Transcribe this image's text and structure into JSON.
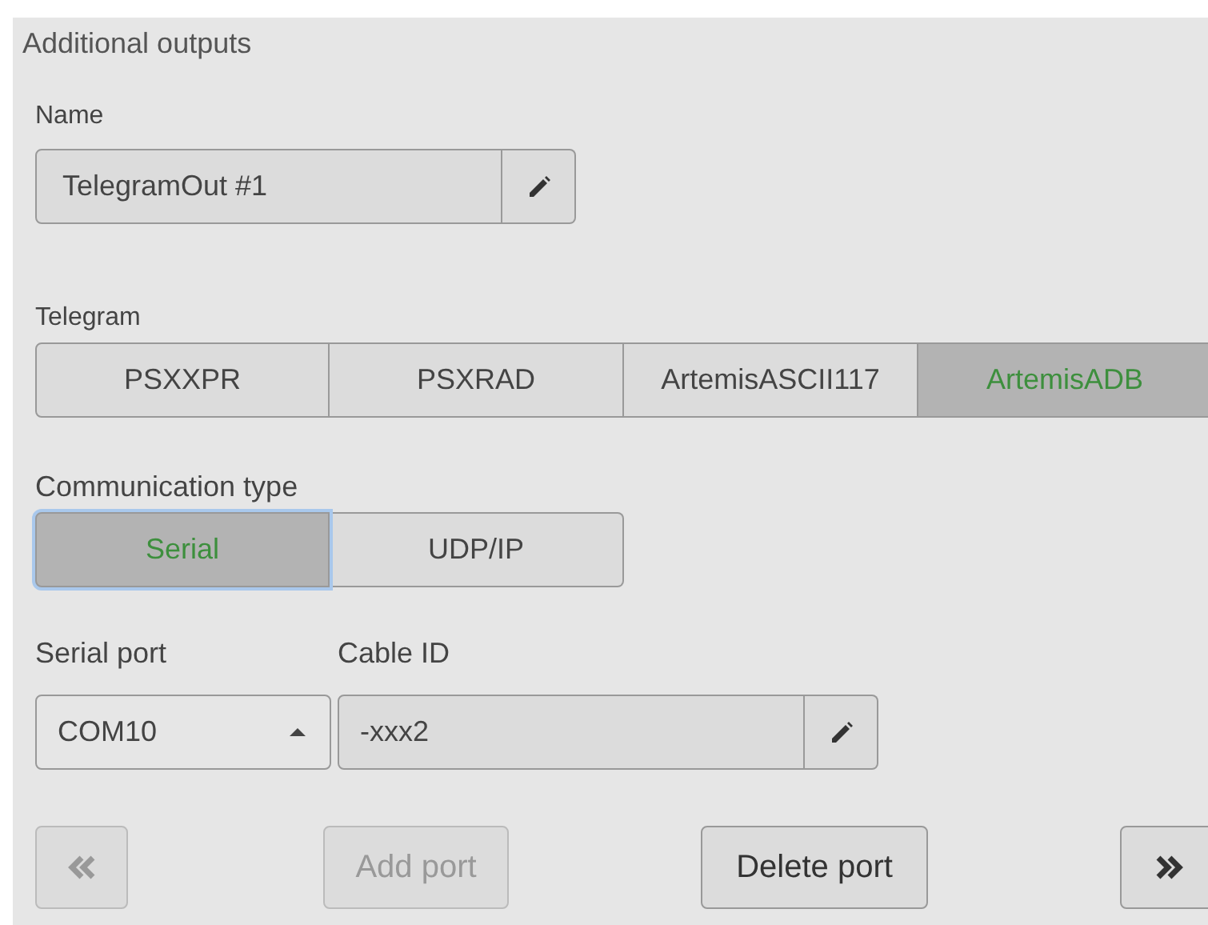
{
  "title": "Additional outputs",
  "name_field": {
    "label": "Name",
    "value": "TelegramOut #1"
  },
  "telegram": {
    "label": "Telegram",
    "options": [
      {
        "label": "PSXXPR",
        "selected": false
      },
      {
        "label": "PSXRAD",
        "selected": false
      },
      {
        "label": "ArtemisASCII117",
        "selected": false
      },
      {
        "label": "ArtemisADB",
        "selected": true
      }
    ]
  },
  "communication_type": {
    "label": "Communication type",
    "options": [
      {
        "label": "Serial",
        "selected": true
      },
      {
        "label": "UDP/IP",
        "selected": false
      }
    ]
  },
  "serial_port": {
    "label": "Serial port",
    "value": "COM10"
  },
  "cable_id": {
    "label": "Cable ID",
    "value": "-xxx2"
  },
  "buttons": [
    {
      "kind": "prev",
      "disabled": true
    },
    {
      "kind": "text",
      "label": "Add port",
      "disabled": true
    },
    {
      "kind": "text",
      "label": "Delete port",
      "disabled": false
    },
    {
      "kind": "next",
      "disabled": false
    }
  ]
}
